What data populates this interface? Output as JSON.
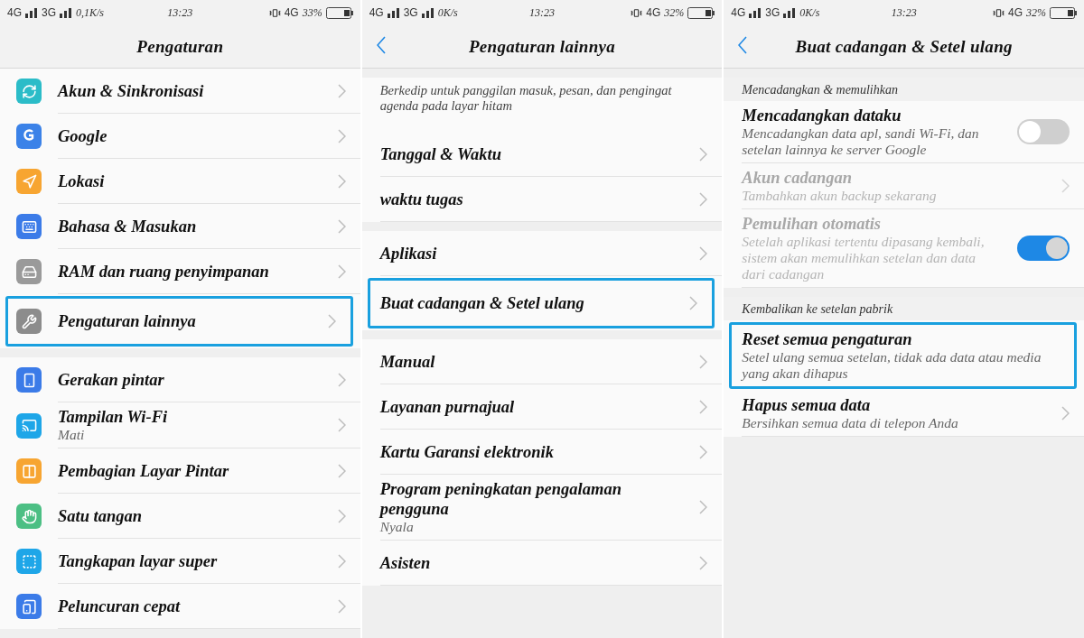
{
  "screens": [
    {
      "status": {
        "net_a": "4G",
        "net_b": "3G",
        "speed": "0,1K/s",
        "time": "13:23",
        "net_c": "4G",
        "battery": "33%"
      },
      "header": {
        "back": false,
        "title": "Pengaturan"
      },
      "sections": [
        {
          "items": [
            {
              "kind": "nav",
              "label": "Akun & Sinkronisasi",
              "color": "#2bbcc8",
              "highlighted": false
            },
            {
              "kind": "nav",
              "label": "Google",
              "color": "#3b82e8",
              "highlighted": false
            },
            {
              "kind": "nav",
              "label": "Lokasi",
              "color": "#f7a531",
              "highlighted": false
            },
            {
              "kind": "nav",
              "label": "Bahasa & Masukan",
              "color": "#3b7be8",
              "highlighted": false
            },
            {
              "kind": "nav",
              "label": "RAM dan ruang penyimpanan",
              "color": "#9a9a9a",
              "highlighted": false
            },
            {
              "kind": "nav",
              "label": "Pengaturan lainnya",
              "color": "#8c8c8c",
              "highlighted": true
            }
          ]
        },
        {
          "items": [
            {
              "kind": "nav",
              "label": "Gerakan pintar",
              "color": "#3b7be8",
              "highlighted": false
            },
            {
              "kind": "nav",
              "label": "Tampilan Wi-Fi",
              "sublabel": "Mati",
              "color": "#1ea6e8",
              "highlighted": false
            },
            {
              "kind": "nav",
              "label": "Pembagian Layar Pintar",
              "color": "#f7a531",
              "highlighted": false
            },
            {
              "kind": "nav",
              "label": "Satu tangan",
              "color": "#4cbf84",
              "highlighted": false
            },
            {
              "kind": "nav",
              "label": "Tangkapan layar super",
              "color": "#1ea6e8",
              "highlighted": false
            },
            {
              "kind": "nav",
              "label": "Peluncuran cepat",
              "color": "#3b7be8",
              "highlighted": false
            }
          ]
        }
      ]
    },
    {
      "status": {
        "net_a": "4G",
        "net_b": "3G",
        "speed": "0K/s",
        "time": "13:23",
        "net_c": "4G",
        "battery": "32%"
      },
      "header": {
        "back": true,
        "title": "Pengaturan lainnya"
      },
      "sections": [
        {
          "items": [
            {
              "kind": "note",
              "label": "Berkedip untuk panggilan masuk, pesan, dan pengingat agenda pada layar hitam"
            },
            {
              "kind": "nav",
              "label": "Tanggal & Waktu",
              "highlighted": false
            },
            {
              "kind": "nav",
              "label": "waktu tugas",
              "highlighted": false
            }
          ]
        },
        {
          "items": [
            {
              "kind": "nav",
              "label": "Aplikasi",
              "highlighted": false
            },
            {
              "kind": "nav",
              "label": "Buat cadangan & Setel ulang",
              "highlighted": true
            }
          ]
        },
        {
          "items": [
            {
              "kind": "nav",
              "label": "Manual",
              "highlighted": false
            },
            {
              "kind": "nav",
              "label": "Layanan purnajual",
              "highlighted": false
            },
            {
              "kind": "nav",
              "label": "Kartu Garansi elektronik",
              "highlighted": false
            },
            {
              "kind": "nav",
              "label": "Program peningkatan pengalaman pengguna",
              "sublabel": "Nyala",
              "highlighted": false
            },
            {
              "kind": "nav",
              "label": "Asisten",
              "highlighted": false
            }
          ]
        }
      ]
    },
    {
      "status": {
        "net_a": "4G",
        "net_b": "3G",
        "speed": "0K/s",
        "time": "13:23",
        "net_c": "4G",
        "battery": "32%"
      },
      "header": {
        "back": true,
        "title": "Buat cadangan & Setel ulang"
      },
      "sections": [
        {
          "title": "Mencadangkan & memulihkan",
          "items": [
            {
              "kind": "toggle",
              "label": "Mencadangkan dataku",
              "sublabel": "Mencadangkan data apl, sandi Wi-Fi, dan setelan lainnya ke server Google",
              "on": false,
              "highlighted": false,
              "disabled": false
            },
            {
              "kind": "nav",
              "label": "Akun cadangan",
              "sublabel": "Tambahkan akun backup sekarang",
              "highlighted": false,
              "disabled": true
            },
            {
              "kind": "toggle",
              "label": "Pemulihan otomatis",
              "sublabel": "Setelah aplikasi tertentu dipasang kembali, sistem akan memulihkan setelan dan data dari cadangan",
              "on": true,
              "highlighted": false,
              "disabled": true
            }
          ]
        },
        {
          "title": "Kembalikan ke setelan pabrik",
          "items": [
            {
              "kind": "plain",
              "label": "Reset semua pengaturan",
              "sublabel": "Setel ulang semua setelan, tidak ada data atau media yang akan dihapus",
              "highlighted": true
            },
            {
              "kind": "nav",
              "label": "Hapus semua data",
              "sublabel": "Bersihkan semua data di telepon Anda",
              "highlighted": false
            }
          ]
        }
      ]
    }
  ]
}
